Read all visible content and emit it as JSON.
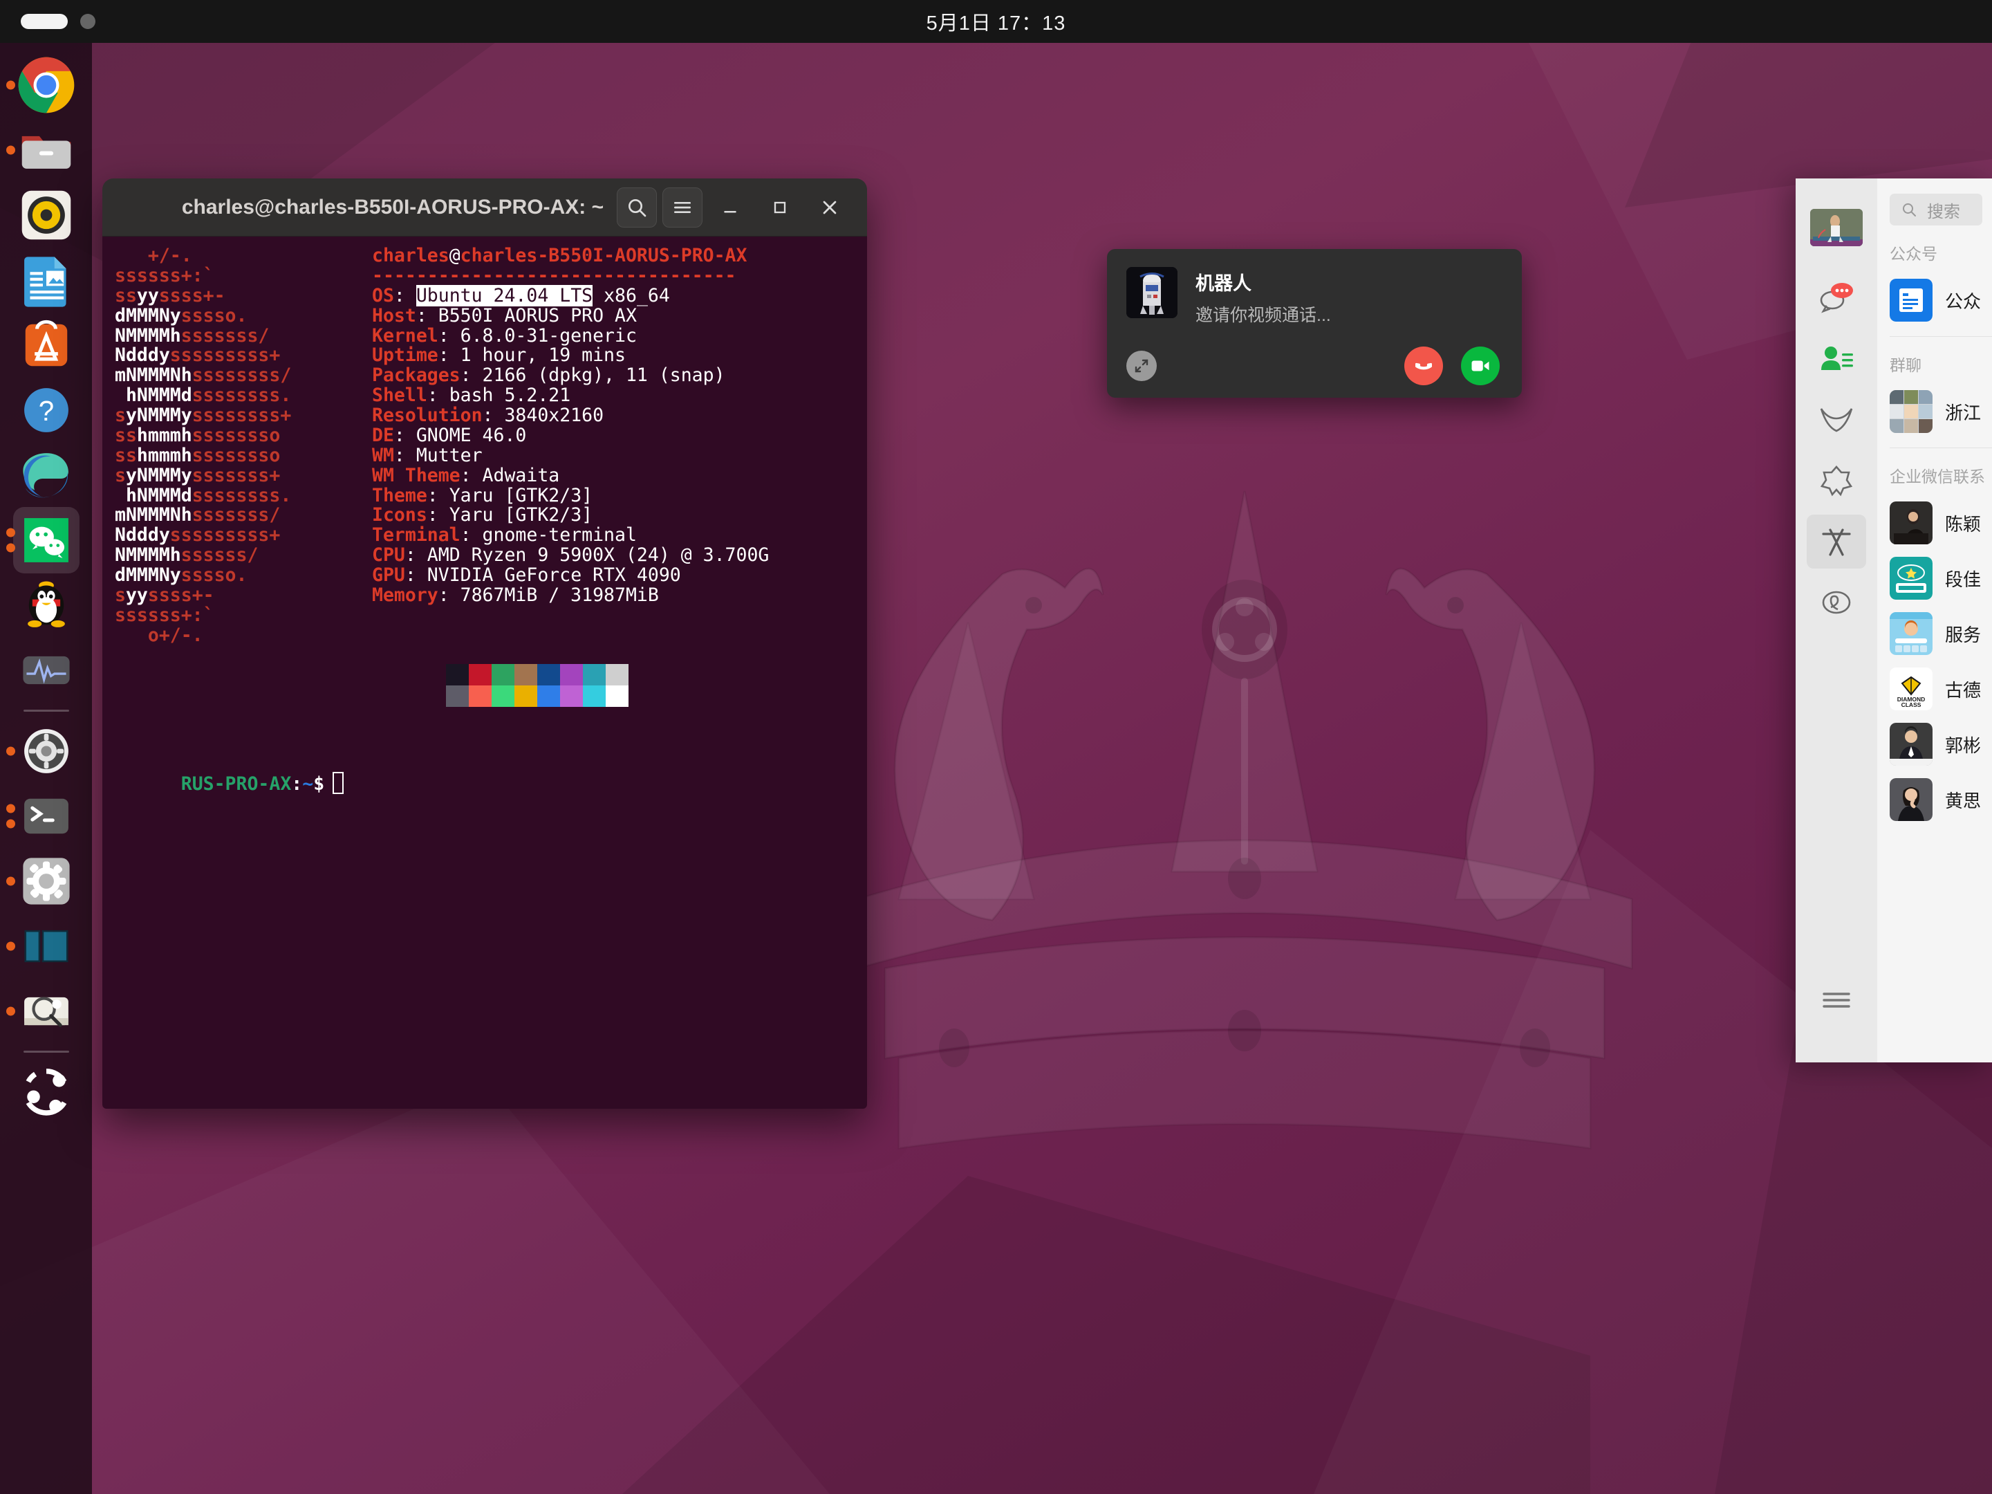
{
  "topbar": {
    "clock": "5月1日 17：13",
    "workspace_indicator": "workspace-pills"
  },
  "dock": {
    "items": [
      {
        "name": "google-chrome",
        "label": "Google Chrome",
        "running": true,
        "dots": 1,
        "active": false
      },
      {
        "name": "files",
        "label": "Files",
        "running": true,
        "dots": 1,
        "active": false
      },
      {
        "name": "rhythmbox",
        "label": "Rhythmbox",
        "running": false,
        "dots": 0,
        "active": false
      },
      {
        "name": "libreoffice-impress",
        "label": "LibreOffice Impress",
        "running": false,
        "dots": 0,
        "active": false
      },
      {
        "name": "ubuntu-software",
        "label": "Ubuntu Software",
        "running": false,
        "dots": 0,
        "active": false
      },
      {
        "name": "help",
        "label": "Help",
        "running": false,
        "dots": 0,
        "active": false
      },
      {
        "name": "microsoft-edge",
        "label": "Microsoft Edge",
        "running": false,
        "dots": 0,
        "active": false
      },
      {
        "name": "wechat",
        "label": "WeChat",
        "running": true,
        "dots": 2,
        "active": true
      },
      {
        "name": "qq",
        "label": "QQ",
        "running": false,
        "dots": 0,
        "active": false
      },
      {
        "name": "system-monitor",
        "label": "System Monitor",
        "running": false,
        "dots": 0,
        "active": false
      },
      {
        "name": "settings",
        "label": "Settings",
        "running": true,
        "dots": 1,
        "active": false
      },
      {
        "name": "terminal",
        "label": "Terminal",
        "running": true,
        "dots": 2,
        "active": false
      },
      {
        "name": "settings-alt",
        "label": "Settings",
        "running": true,
        "dots": 1,
        "active": true
      },
      {
        "name": "window-tiling",
        "label": "Tiling Assistant",
        "running": true,
        "dots": 1,
        "active": false
      },
      {
        "name": "screenshot",
        "label": "Screenshot",
        "running": true,
        "dots": 1,
        "active": false
      },
      {
        "name": "show-applications",
        "label": "Show Applications",
        "running": false,
        "dots": 0,
        "active": false
      }
    ]
  },
  "terminal": {
    "title": "charles@charles-B550I-AORUS-PRO-AX: ~",
    "titlebar_buttons": [
      {
        "name": "search-icon",
        "label": "Search"
      },
      {
        "name": "hamburger-menu-icon",
        "label": "Menu"
      },
      {
        "name": "minimize-icon",
        "label": "Minimize"
      },
      {
        "name": "maximize-icon",
        "label": "Maximize"
      },
      {
        "name": "close-icon",
        "label": "Close"
      }
    ],
    "neofetch": {
      "header": "charles@charles-B550I-AORUS-PRO-AX",
      "rule": "---------------------------------",
      "highlight": "Ubuntu 24.04 LTS",
      "rows": [
        {
          "key": "OS",
          "value": "Ubuntu 24.04 LTS x86_64",
          "highlight_part": "Ubuntu 24.04 LTS",
          "rest": " x86_64"
        },
        {
          "key": "Host",
          "value": "B550I AORUS PRO AX"
        },
        {
          "key": "Kernel",
          "value": "6.8.0-31-generic"
        },
        {
          "key": "Uptime",
          "value": "1 hour, 19 mins"
        },
        {
          "key": "Packages",
          "value": "2166 (dpkg), 11 (snap)"
        },
        {
          "key": "Shell",
          "value": "bash 5.2.21"
        },
        {
          "key": "Resolution",
          "value": "3840x2160"
        },
        {
          "key": "DE",
          "value": "GNOME 46.0"
        },
        {
          "key": "WM",
          "value": "Mutter"
        },
        {
          "key": "WM Theme",
          "value": "Adwaita"
        },
        {
          "key": "Theme",
          "value": "Yaru [GTK2/3]"
        },
        {
          "key": "Icons",
          "value": "Yaru [GTK2/3]"
        },
        {
          "key": "Terminal",
          "value": "gnome-terminal"
        },
        {
          "key": "CPU",
          "value": "AMD Ryzen 9 5900X (24) @ 3.700G"
        },
        {
          "key": "GPU",
          "value": "NVIDIA GeForce RTX 4090"
        },
        {
          "key": "Memory",
          "value": "7867MiB / 31987MiB"
        }
      ],
      "ascii_art": [
        "   +/-.",
        "ssssss+:`",
        "ssyyssss+-",
        "dMMMNysssso.",
        "NMMMMhsssssss/",
        "Ndddysssssssss+",
        "mNMMMNhssssssss/",
        " hNMMMdssssssss.",
        "syNMMMyssssssss+",
        "sshmmmhssssssso",
        "sshmmmhssssssso",
        "syNMMMysssssss+",
        " hNMMMdssssssss.",
        "mNMMMNhsssssss/",
        "Ndddysssssssss+",
        "NMMMMhssssss/",
        "dMMMNysssso.",
        "syyssss+-",
        "ssssss+:`",
        "   o+/-."
      ],
      "palette_row1": [
        "#1a1523",
        "#c4172a",
        "#2da360",
        "#a2744f",
        "#124a8e",
        "#a344bd",
        "#2aa1b3",
        "#cfcfcf"
      ],
      "palette_row2": [
        "#5e5c68",
        "#f7604f",
        "#3bd97b",
        "#eab000",
        "#2f7ee8",
        "#bf62d4",
        "#34cde0",
        "#ffffff"
      ]
    },
    "prompt": {
      "user_host": "RUS-PRO-AX",
      "colon": ":",
      "path": "~",
      "dollar": "$"
    }
  },
  "call_popup": {
    "contact_name": "机器人",
    "status_text": "邀请你视频通话...",
    "avatar_alt": "r2d2-avatar",
    "expand_label": "expand-icon",
    "decline_label": "decline-call",
    "accept_label": "accept-video-call",
    "decline_color": "#f2564a",
    "accept_color": "#09b83e"
  },
  "wechat": {
    "rail": [
      {
        "name": "profile-avatar",
        "label": "Profile"
      },
      {
        "name": "chats-icon",
        "label": "聊天",
        "badge": true
      },
      {
        "name": "contacts-icon",
        "label": "通讯录",
        "active_green": true
      },
      {
        "name": "moments-icon",
        "label": "朋友圈"
      },
      {
        "name": "favorites-icon",
        "label": "收藏"
      },
      {
        "name": "sticker-icon",
        "label": "表情",
        "active": true
      },
      {
        "name": "mini-program-icon",
        "label": "小程序"
      }
    ],
    "hamburger": "more-menu-icon",
    "search": {
      "placeholder": "搜索"
    },
    "groups": [
      {
        "title": "公众号",
        "rows": [
          {
            "name": "公众",
            "avatar": "official-account-blue"
          }
        ]
      },
      {
        "title": "群聊",
        "rows": [
          {
            "name": "浙江",
            "avatar": "group-mosaic"
          }
        ]
      },
      {
        "title": "企业微信联系",
        "rows": [
          {
            "name": "陈颖",
            "avatar": "photo-woman-1"
          },
          {
            "name": "段佳",
            "avatar": "logo-haiwangxingchen"
          },
          {
            "name": "服务",
            "avatar": "service-card"
          },
          {
            "name": "古德",
            "avatar": "diamond-class"
          },
          {
            "name": "郭彬",
            "avatar": "photo-man-suit"
          },
          {
            "name": "黄思",
            "avatar": "photo-woman-2"
          }
        ]
      }
    ]
  },
  "wallpaper": {
    "name": "ubuntu-noble-numbat-crown",
    "base_color": "#6e2350"
  }
}
